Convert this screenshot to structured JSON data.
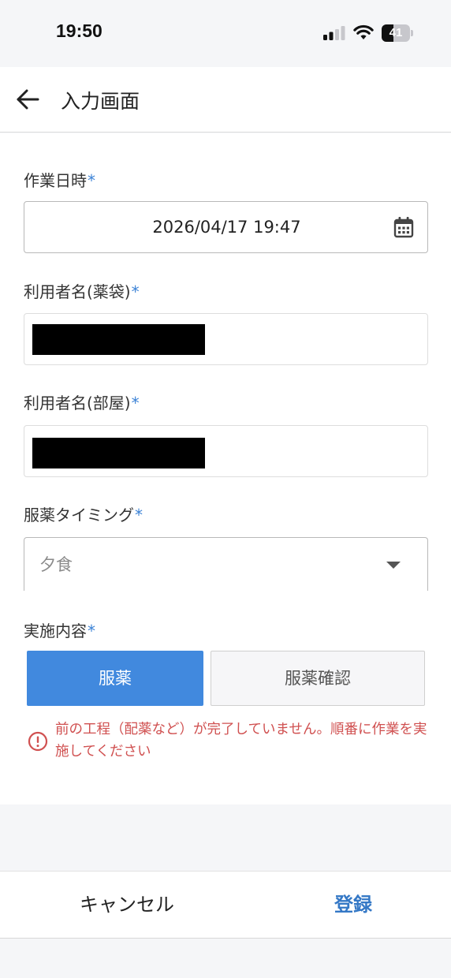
{
  "status_bar": {
    "time": "19:50",
    "battery_level": "41",
    "battery_fraction": 0.41
  },
  "header": {
    "title": "入力画面",
    "back_icon": "arrow-left-icon"
  },
  "form": {
    "required_mark": "*",
    "work_datetime": {
      "label": "作業日時",
      "value": "2026/04/17 19:47",
      "icon": "calendar-icon"
    },
    "user_name_bag": {
      "label": "利用者名(薬袋)"
    },
    "user_name_room": {
      "label": "利用者名(部屋)"
    },
    "timing": {
      "label": "服薬タイミング",
      "value": "夕食",
      "icon": "dropdown-arrow-icon"
    },
    "action": {
      "label": "実施内容",
      "options": [
        "服薬",
        "服薬確認"
      ],
      "selected": "服薬"
    },
    "error": {
      "icon": "error-circle-icon",
      "message": "前の工程（配薬など）が完了していません。順番に作業を実施してください"
    }
  },
  "footer": {
    "cancel_label": "キャンセル",
    "submit_label": "登録"
  },
  "colors": {
    "primary": "#4189de",
    "required": "#3b82d6",
    "error": "#d05050",
    "submit_text": "#3478c6"
  }
}
